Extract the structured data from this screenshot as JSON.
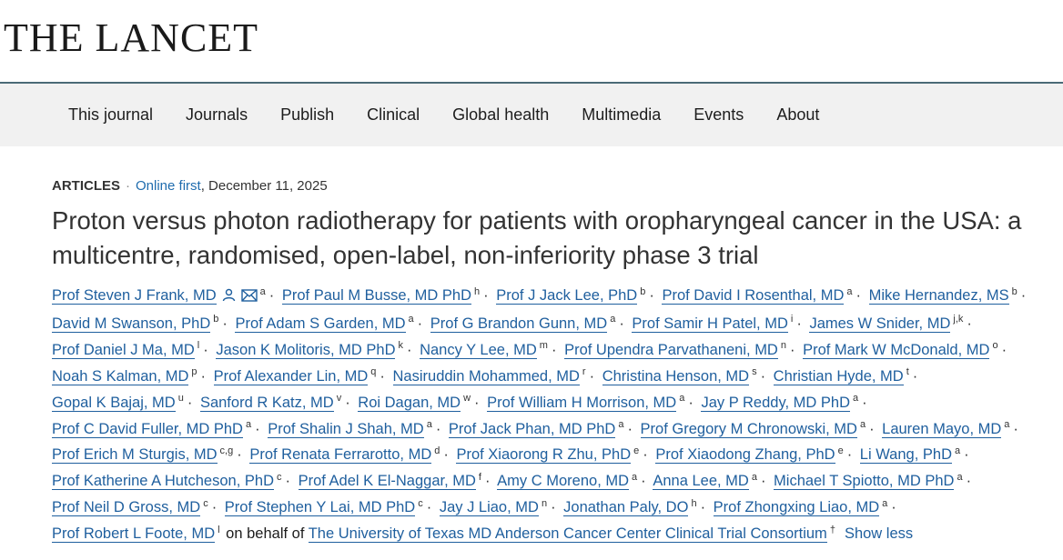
{
  "brand": {
    "logo_text": "THE LANCET"
  },
  "nav": {
    "items": [
      "This journal",
      "Journals",
      "Publish",
      "Clinical",
      "Global health",
      "Multimedia",
      "Events",
      "About"
    ]
  },
  "article": {
    "type": "ARTICLES",
    "online_first_label": "Online first",
    "date": ", December 11, 2025",
    "title": "Proton versus photon radiotherapy for patients with oropharyngeal cancer in the USA: a multicentre, randomised, open-label, non-inferiority phase 3 trial",
    "on_behalf_text": "on behalf of",
    "consortium": {
      "name": "The University of Texas MD Anderson Cancer Center Clinical Trial Consortium",
      "aff": "†"
    },
    "show_less_label": "Show less",
    "authors": [
      {
        "name": "Prof Steven J Frank, MD",
        "aff": "a",
        "icons": [
          "person-icon",
          "mail-icon"
        ]
      },
      {
        "name": "Prof Paul M Busse, MD PhD",
        "aff": "h"
      },
      {
        "name": "Prof J Jack Lee, PhD",
        "aff": "b"
      },
      {
        "name": "Prof David I Rosenthal, MD",
        "aff": "a"
      },
      {
        "name": "Mike Hernandez, MS",
        "aff": "b"
      },
      {
        "name": "David M Swanson, PhD",
        "aff": "b"
      },
      {
        "name": "Prof Adam S Garden, MD",
        "aff": "a"
      },
      {
        "name": "Prof G Brandon Gunn, MD",
        "aff": "a"
      },
      {
        "name": "Prof Samir H Patel, MD",
        "aff": "i"
      },
      {
        "name": "James W Snider, MD",
        "aff": "j,k"
      },
      {
        "name": "Prof Daniel J Ma, MD",
        "aff": "l"
      },
      {
        "name": "Jason K Molitoris, MD PhD",
        "aff": "k"
      },
      {
        "name": "Nancy Y Lee, MD",
        "aff": "m"
      },
      {
        "name": "Prof Upendra Parvathaneni, MD",
        "aff": "n"
      },
      {
        "name": "Prof Mark W McDonald, MD",
        "aff": "o"
      },
      {
        "name": "Noah S Kalman, MD",
        "aff": "p"
      },
      {
        "name": "Prof Alexander Lin, MD",
        "aff": "q"
      },
      {
        "name": "Nasiruddin Mohammed, MD",
        "aff": "r"
      },
      {
        "name": "Christina Henson, MD",
        "aff": "s"
      },
      {
        "name": "Christian Hyde, MD",
        "aff": "t"
      },
      {
        "name": "Gopal K Bajaj, MD",
        "aff": "u"
      },
      {
        "name": "Sanford R Katz, MD",
        "aff": "v"
      },
      {
        "name": "Roi Dagan, MD",
        "aff": "w"
      },
      {
        "name": "Prof William H Morrison, MD",
        "aff": "a"
      },
      {
        "name": "Jay P Reddy, MD PhD",
        "aff": "a"
      },
      {
        "name": "Prof C David Fuller, MD PhD",
        "aff": "a"
      },
      {
        "name": "Prof Shalin J Shah, MD",
        "aff": "a"
      },
      {
        "name": "Prof Jack Phan, MD PhD",
        "aff": "a"
      },
      {
        "name": "Prof Gregory M Chronowski, MD",
        "aff": "a"
      },
      {
        "name": "Lauren Mayo, MD",
        "aff": "a"
      },
      {
        "name": "Prof Erich M Sturgis, MD",
        "aff": "c,g"
      },
      {
        "name": "Prof Renata Ferrarotto, MD",
        "aff": "d"
      },
      {
        "name": "Prof Xiaorong R Zhu, PhD",
        "aff": "e"
      },
      {
        "name": "Prof Xiaodong Zhang, PhD",
        "aff": "e"
      },
      {
        "name": "Li Wang, PhD",
        "aff": "a"
      },
      {
        "name": "Prof Katherine A Hutcheson, PhD",
        "aff": "c"
      },
      {
        "name": "Prof Adel K El-Naggar, MD",
        "aff": "f"
      },
      {
        "name": "Amy C Moreno, MD",
        "aff": "a"
      },
      {
        "name": "Anna Lee, MD",
        "aff": "a"
      },
      {
        "name": "Michael T Spiotto, MD PhD",
        "aff": "a"
      },
      {
        "name": "Prof Neil D Gross, MD",
        "aff": "c"
      },
      {
        "name": "Prof Stephen Y Lai, MD PhD",
        "aff": "c"
      },
      {
        "name": "Jay J Liao, MD",
        "aff": "n"
      },
      {
        "name": "Jonathan Paly, DO",
        "aff": "h"
      },
      {
        "name": "Prof Zhongxing Liao, MD",
        "aff": "a"
      },
      {
        "name": "Prof Robert L Foote, MD",
        "aff": "l"
      }
    ]
  },
  "colors": {
    "link": "#1f5f9e",
    "nav_bg": "#f1f1f1",
    "nav_border": "#4a6a77"
  }
}
